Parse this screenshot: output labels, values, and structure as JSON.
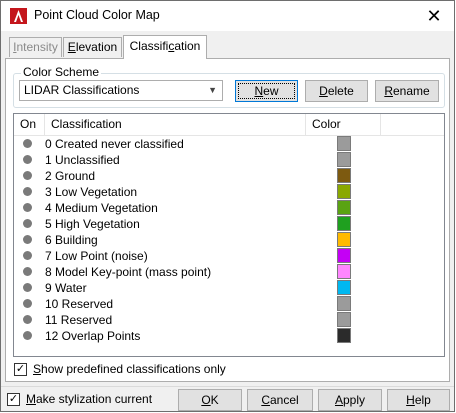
{
  "window": {
    "title": "Point Cloud Color Map",
    "close_glyph": "✕"
  },
  "tabs": [
    {
      "label": "Intensity",
      "mnemonic": "I",
      "rest": "ntensity",
      "state": "disabled"
    },
    {
      "label": "Elevation",
      "mnemonic": "E",
      "rest": "levation",
      "state": "normal"
    },
    {
      "label": "Classification",
      "pre": "Classifi",
      "mnemonic": "c",
      "rest": "ation",
      "state": "active"
    }
  ],
  "color_scheme": {
    "group_label": "Color Scheme",
    "selected": "LIDAR Classifications",
    "buttons": {
      "new": {
        "label": "New",
        "mnemonic": "N",
        "rest": "ew"
      },
      "delete": {
        "label": "Delete",
        "mnemonic": "D",
        "rest": "elete"
      },
      "rename": {
        "label": "Rename",
        "mnemonic": "R",
        "rest": "ename"
      }
    }
  },
  "classification_list": {
    "columns": {
      "on": "On",
      "classification": "Classification",
      "color": "Color"
    },
    "rows": [
      {
        "label": "0 Created never classified",
        "color": "#9b9b9b"
      },
      {
        "label": "1 Unclassified",
        "color": "#9b9b9b"
      },
      {
        "label": "2 Ground",
        "color": "#7d5a10"
      },
      {
        "label": "3 Low Vegetation",
        "color": "#8aa800"
      },
      {
        "label": "4 Medium Vegetation",
        "color": "#5aa312"
      },
      {
        "label": "5 High Vegetation",
        "color": "#1fa01f"
      },
      {
        "label": "6 Building",
        "color": "#ffba00"
      },
      {
        "label": "7 Low Point (noise)",
        "color": "#c400f5"
      },
      {
        "label": "8 Model Key-point (mass point)",
        "color": "#ff86ff"
      },
      {
        "label": "9 Water",
        "color": "#00b8f0"
      },
      {
        "label": "10 Reserved",
        "color": "#9b9b9b"
      },
      {
        "label": "11 Reserved",
        "color": "#9b9b9b"
      },
      {
        "label": "12 Overlap Points",
        "color": "#2b2b2b"
      }
    ]
  },
  "show_predefined": {
    "checked": true,
    "mnemonic": "S",
    "rest": "how predefined classifications only"
  },
  "footer": {
    "make_current": {
      "checked": true,
      "mnemonic": "M",
      "rest": "ake stylization current"
    },
    "ok": {
      "label": "OK",
      "mnemonic": "O",
      "rest": "K"
    },
    "cancel": {
      "label": "Cancel",
      "mnemonic": "C",
      "rest": "ancel"
    },
    "apply": {
      "label": "Apply",
      "mnemonic": "A",
      "rest": "pply"
    },
    "help": {
      "label": "Help",
      "mnemonic": "H",
      "rest": "elp"
    }
  },
  "check_glyph": "✓",
  "combo_arrow": "▼",
  "icons": {
    "app": "autocad-logo-icon",
    "close": "close-icon",
    "dropdown": "chevron-down-icon",
    "status": "status-dot-icon"
  },
  "accent": "#0078d7"
}
